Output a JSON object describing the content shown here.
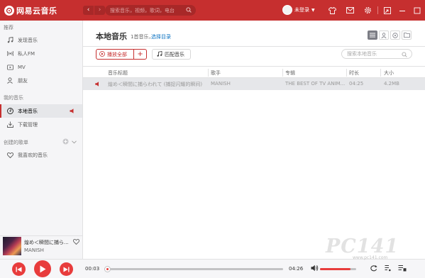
{
  "app": {
    "title": "网易云音乐"
  },
  "search": {
    "placeholder": "搜索音乐，视频，歌词，电台"
  },
  "user": {
    "name": "未登录"
  },
  "sidebar": {
    "sections": [
      {
        "label": "推荐"
      },
      {
        "label": "我的音乐"
      },
      {
        "label": "创建的歌单"
      }
    ],
    "items": [
      {
        "label": "发现音乐",
        "icon": "music-note-icon"
      },
      {
        "label": "私人FM",
        "icon": "radio-icon"
      },
      {
        "label": "MV",
        "icon": "mv-icon"
      },
      {
        "label": "朋友",
        "icon": "friends-icon"
      },
      {
        "label": "本地音乐",
        "icon": "local-music-icon",
        "active": true
      },
      {
        "label": "下载管理",
        "icon": "download-icon"
      },
      {
        "label": "我喜欢的音乐",
        "icon": "heart-icon"
      }
    ]
  },
  "main": {
    "title": "本地音乐",
    "count": "1首音乐，",
    "choose_dir": "选择目录",
    "play_all": "播放全部",
    "match": "匹配音乐",
    "search_placeholder": "搜索本地音乐"
  },
  "table": {
    "columns": [
      "音乐标题",
      "歌手",
      "专辑",
      "时长",
      "大小"
    ],
    "rows": [
      {
        "title": "煌め＜瞬間に捕らわれて (捕捉闪耀的瞬间)",
        "artist": "MANISH",
        "album": "THE BEST OF TV ANIM...",
        "duration": "04:25",
        "size": "4.2MB"
      }
    ]
  },
  "now_playing": {
    "title": "煌め＜瞬間に捕ら...",
    "artist": "MANISH"
  },
  "player": {
    "elapsed": "00:03",
    "total": "04:26",
    "progress": 0.012,
    "volume": 0.85
  },
  "watermark": {
    "text": "PC141",
    "sub": "www.pc141.com"
  },
  "colors": {
    "brand": "#c62f2f",
    "accent": "#e83c3c",
    "link": "#0c73c2"
  }
}
